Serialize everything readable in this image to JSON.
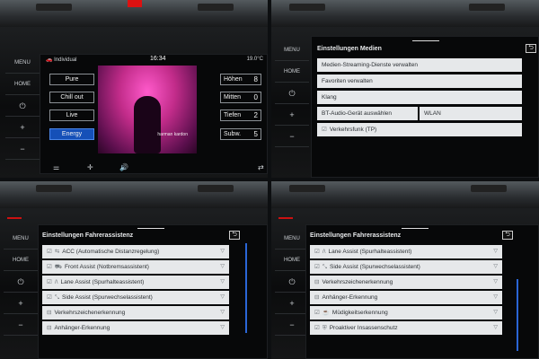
{
  "side": {
    "menu": "MENU",
    "home": "HOME",
    "power": "⏻",
    "plus": "+",
    "minus": "−"
  },
  "media": {
    "status": {
      "profile": "🚗 Individual",
      "time": "16:34",
      "temp": "19.0°C"
    },
    "presets": [
      "Pure",
      "Chill out",
      "Live",
      "Energy"
    ],
    "active_preset": "Energy",
    "brand": "harman kardon",
    "eq": [
      {
        "label": "Höhen",
        "value": "8"
      },
      {
        "label": "Mitten",
        "value": "0"
      },
      {
        "label": "Tiefen",
        "value": "2"
      },
      {
        "label": "Subw.",
        "value": "5"
      }
    ],
    "bottom_icons": [
      "⚌",
      "✛",
      "🔊",
      "⇄"
    ]
  },
  "medien": {
    "title": "Einstellungen Medien",
    "rows": [
      "Medien-Streaming-Dienste verwalten",
      "Favoriten verwalten",
      "Klang",
      "BT-Audio-Gerät auswählen",
      "WLAN",
      "Verkehrsfunk (TP)"
    ],
    "check": "☑",
    "back": "⮌"
  },
  "fahrer1": {
    "title": "Einstellungen Fahrerassistenz",
    "rows": [
      {
        "check": "☑",
        "icon": "⇆",
        "label": "ACC (Automatische Distanzregelung)"
      },
      {
        "check": "☑",
        "icon": "⛟",
        "label": "Front Assist (Notbremsassistent)"
      },
      {
        "check": "☑",
        "icon": "/\\",
        "label": "Lane Assist (Spurhalteassistent)"
      },
      {
        "check": "☑",
        "icon": "⤡",
        "label": "Side Assist (Spurwechselassistent)"
      },
      {
        "check": "",
        "icon": "⊟",
        "label": "Verkehrszeichenerkennung"
      },
      {
        "check": "",
        "icon": "⊟",
        "label": "Anhänger-Erkennung"
      }
    ],
    "chevron": "▽"
  },
  "fahrer2": {
    "title": "Einstellungen Fahrerassistenz",
    "rows": [
      {
        "check": "☑",
        "icon": "/\\",
        "label": "Lane Assist (Spurhalteassistent)"
      },
      {
        "check": "☑",
        "icon": "⤡",
        "label": "Side Assist (Spurwechselassistent)"
      },
      {
        "check": "",
        "icon": "⊟",
        "label": "Verkehrszeichenerkennung"
      },
      {
        "check": "",
        "icon": "⊟",
        "label": "Anhänger-Erkennung"
      },
      {
        "check": "☑",
        "icon": "☕",
        "label": "Müdigkeitserkennung"
      },
      {
        "check": "☑",
        "icon": "⛨",
        "label": "Proaktiver Insassenschutz"
      }
    ],
    "chevron": "▽"
  }
}
